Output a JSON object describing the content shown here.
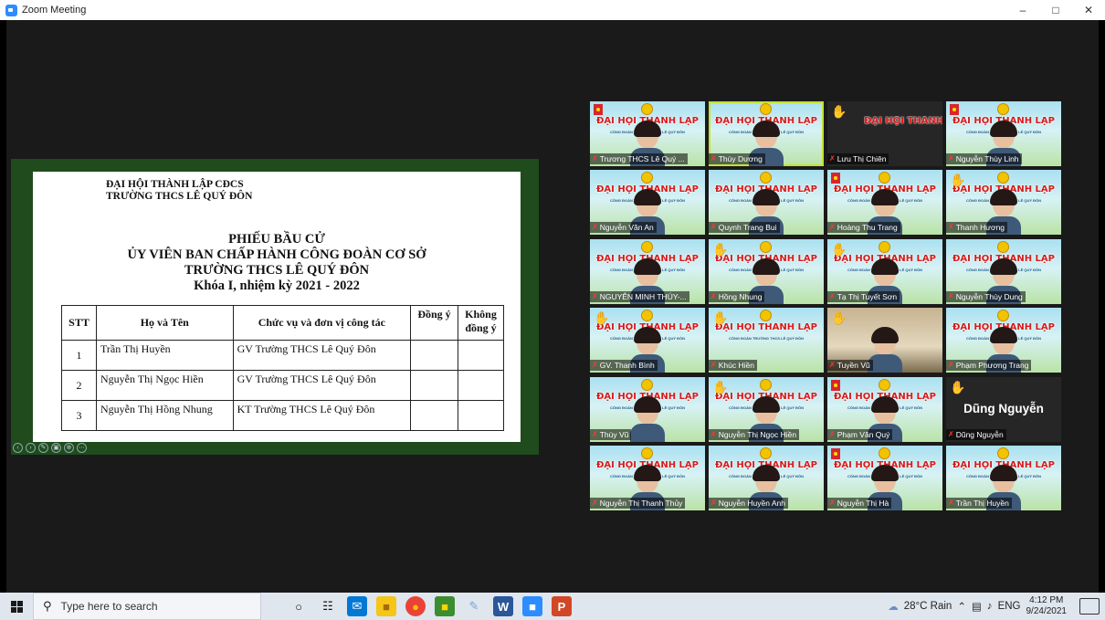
{
  "window": {
    "title": "Zoom Meeting"
  },
  "document": {
    "org_line1": "ĐẠI HỘI THÀNH LẬP CĐCS",
    "org_line2": "TRƯỜNG THCS LÊ QUÝ ĐÔN",
    "title_line1": "PHIẾU BẦU CỬ",
    "title_line2": "ỦY VIÊN BAN CHẤP HÀNH CÔNG ĐOÀN CƠ SỞ",
    "title_line3": "TRƯỜNG THCS LÊ QUÝ ĐÔN",
    "title_line4": "Khóa I, nhiệm kỳ 2021 - 2022",
    "table": {
      "headers": [
        "STT",
        "Họ và Tên",
        "Chức vụ và đơn vị công tác",
        "Đồng ý",
        "Không đồng ý"
      ],
      "rows": [
        [
          "1",
          "Trần Thị Huyền",
          "GV Trường THCS Lê Quý Đôn",
          "",
          ""
        ],
        [
          "2",
          "Nguyễn Thị Ngọc Hiền",
          "GV Trường THCS Lê Quý Đôn",
          "",
          ""
        ],
        [
          "3",
          "Nguyễn Thị Hồng Nhung",
          "KT Trường THCS Lê Quý Đôn",
          "",
          ""
        ]
      ]
    }
  },
  "banner": {
    "title": "ĐẠI HỘI THÀNH LẬP",
    "subtitle": "CÔNG ĐOÀN TRƯỜNG THCS LÊ QUÝ ĐÔN"
  },
  "participants": [
    {
      "name": "Trương THCS Lê Quý ...",
      "style": "banner",
      "face": true,
      "hand": false,
      "flag": true
    },
    {
      "name": "Thùy Dương",
      "style": "banner",
      "face": true,
      "hand": false,
      "active": true
    },
    {
      "name": "Lưu Thị Chiên",
      "style": "banner",
      "face": false,
      "hand": true,
      "dark": true
    },
    {
      "name": "Nguyễn Thùy Linh",
      "style": "banner",
      "face": true,
      "hand": false,
      "flag": true
    },
    {
      "name": "Nguyễn Văn An",
      "style": "banner",
      "face": true,
      "hand": false
    },
    {
      "name": "Quynh Trang Bui",
      "style": "banner",
      "face": true,
      "hand": false
    },
    {
      "name": "Hoàng Thu Trang",
      "style": "banner",
      "face": true,
      "hand": false,
      "flag": true
    },
    {
      "name": "Thanh Hương",
      "style": "banner",
      "face": true,
      "hand": true
    },
    {
      "name": "NGUYỄN MINH THÚY-...",
      "style": "banner",
      "face": true,
      "hand": false
    },
    {
      "name": "Hồng Nhung",
      "style": "banner",
      "face": true,
      "hand": true
    },
    {
      "name": "Tạ Thị Tuyết Sơn",
      "style": "banner",
      "face": true,
      "hand": true
    },
    {
      "name": "Nguyễn Thùy Dung",
      "style": "banner",
      "face": true,
      "hand": false
    },
    {
      "name": "GV. Thanh Bình",
      "style": "banner",
      "face": true,
      "hand": true
    },
    {
      "name": "Khúc Hiền",
      "style": "banner",
      "face": false,
      "hand": true
    },
    {
      "name": "Tuyền Vũ",
      "style": "video",
      "face": true,
      "hand": true
    },
    {
      "name": "Phạm Phương Trang",
      "style": "banner",
      "face": true,
      "hand": false
    },
    {
      "name": "Thùy Vũ",
      "style": "banner",
      "face": true,
      "hand": false
    },
    {
      "name": "Nguyễn Thị Ngọc Hiền",
      "style": "banner",
      "face": true,
      "hand": true
    },
    {
      "name": "Phạm Văn Quý",
      "style": "banner",
      "face": true,
      "hand": false,
      "flag": true
    },
    {
      "name": "Dũng Nguyễn",
      "style": "dark",
      "face": false,
      "hand": true,
      "bigname": "Dũng Nguyễn"
    },
    {
      "name": "Nguyễn Thị Thanh Thủy",
      "style": "banner",
      "face": true,
      "hand": false
    },
    {
      "name": "Nguyễn Huyền Anh",
      "style": "banner",
      "face": true,
      "hand": false
    },
    {
      "name": "Nguyễn Thị Hà",
      "style": "banner",
      "face": true,
      "hand": false,
      "flag": true
    },
    {
      "name": "Trần Thị Huyền",
      "style": "banner",
      "face": true,
      "hand": false
    }
  ],
  "taskbar": {
    "search_placeholder": "Type here to search",
    "weather": "28°C Rain",
    "language": "ENG",
    "time": "4:12 PM",
    "date": "9/24/2021"
  },
  "colors": {
    "share_bg": "#1f4b1d",
    "active_speaker": "#c3e234",
    "banner_red": "#d71a1a",
    "zoom_blue": "#2d8cff"
  }
}
